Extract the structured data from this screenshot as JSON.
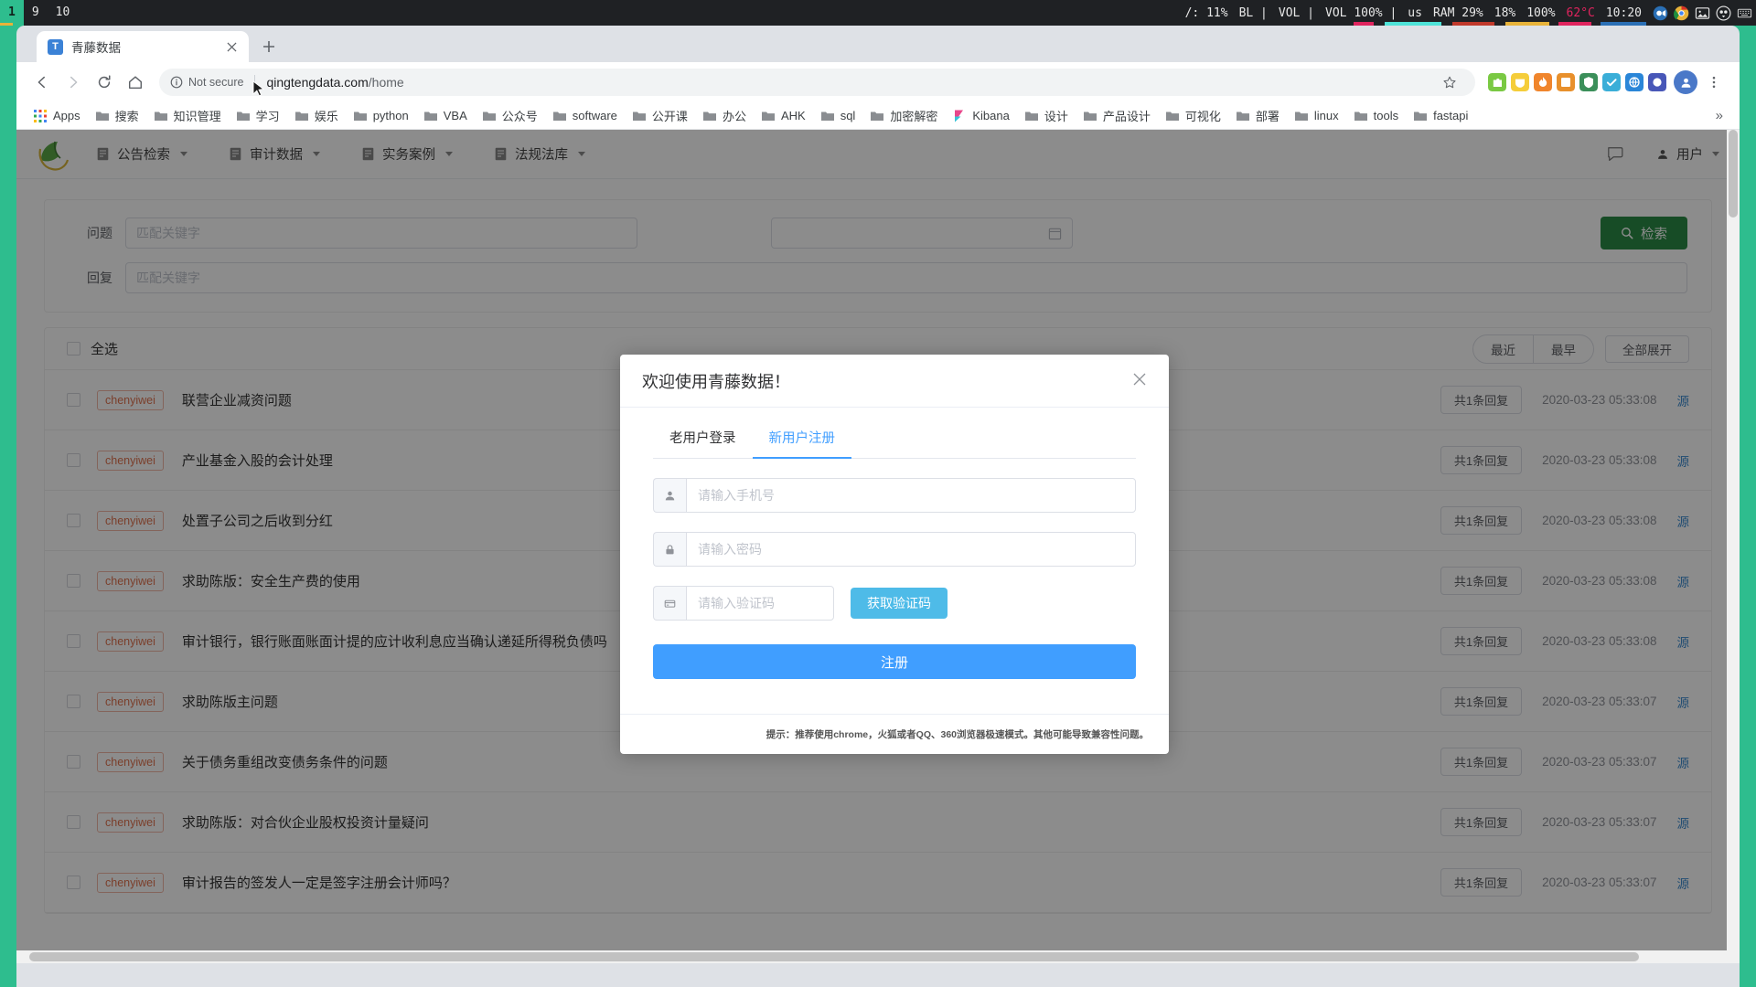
{
  "os_bar": {
    "workspaces": [
      "1",
      "9",
      "10"
    ],
    "active_workspace": "1",
    "segments": [
      {
        "name": "brightness",
        "text": "/: 11%"
      },
      {
        "name": "backlight",
        "text": "BL |"
      },
      {
        "name": "volume-label",
        "text": "VOL |"
      },
      {
        "name": "volume-level",
        "text": "VOL 100% |"
      },
      {
        "name": "keyboard-layout",
        "text": "us"
      },
      {
        "name": "ram",
        "text": "RAM 29%"
      },
      {
        "name": "cpu",
        "text": "18%"
      },
      {
        "name": "battery",
        "text": "100%"
      },
      {
        "name": "temperature",
        "text": "62°C"
      },
      {
        "name": "clock",
        "text": "10:20"
      }
    ],
    "tray_icons": [
      "camera-icon",
      "chrome-icon",
      "image-icon",
      "owl-icon",
      "keyboard-icon"
    ]
  },
  "browser": {
    "tab": {
      "title": "青藤数据",
      "favicon_letter": "T"
    },
    "new_tab_label": "+",
    "nav": {
      "back": "back-icon",
      "forward": "forward-icon",
      "reload": "reload-icon",
      "home": "home-icon"
    },
    "omnibox": {
      "security_text": "Not secure",
      "url_host": "qingtengdata.com",
      "url_path": "/home"
    },
    "bookmarks": [
      {
        "label": "Apps",
        "icon": "apps-grid-icon"
      },
      {
        "label": "搜索",
        "icon": "folder-icon"
      },
      {
        "label": "知识管理",
        "icon": "folder-icon"
      },
      {
        "label": "学习",
        "icon": "folder-icon"
      },
      {
        "label": "娱乐",
        "icon": "folder-icon"
      },
      {
        "label": "python",
        "icon": "folder-icon"
      },
      {
        "label": "VBA",
        "icon": "folder-icon"
      },
      {
        "label": "公众号",
        "icon": "folder-icon"
      },
      {
        "label": "software",
        "icon": "folder-icon"
      },
      {
        "label": "公开课",
        "icon": "folder-icon"
      },
      {
        "label": "办公",
        "icon": "folder-icon"
      },
      {
        "label": "AHK",
        "icon": "folder-icon"
      },
      {
        "label": "sql",
        "icon": "folder-icon"
      },
      {
        "label": "加密解密",
        "icon": "folder-icon"
      },
      {
        "label": "Kibana",
        "icon": "kibana-icon"
      },
      {
        "label": "设计",
        "icon": "folder-icon"
      },
      {
        "label": "产品设计",
        "icon": "folder-icon"
      },
      {
        "label": "可视化",
        "icon": "folder-icon"
      },
      {
        "label": "部署",
        "icon": "folder-icon"
      },
      {
        "label": "linux",
        "icon": "folder-icon"
      },
      {
        "label": "tools",
        "icon": "folder-icon"
      },
      {
        "label": "fastapi",
        "icon": "folder-icon"
      }
    ],
    "bookmarks_overflow": "»"
  },
  "site": {
    "nav_items": [
      {
        "label": "公告检索"
      },
      {
        "label": "审计数据"
      },
      {
        "label": "实务案例"
      },
      {
        "label": "法规法库"
      }
    ],
    "user_label": "用户"
  },
  "search_panel": {
    "question_label": "问题",
    "question_placeholder": "匹配关键字",
    "reply_label": "回复",
    "reply_placeholder": "匹配关键字",
    "date_placeholder": "",
    "search_button": "检索"
  },
  "list_header": {
    "select_all": "全选",
    "sort_recent": "最近",
    "sort_earliest": "最早",
    "expand_all": "全部展开"
  },
  "rows": [
    {
      "user": "chenyiwei",
      "question": "联营企业减资问题",
      "replies": "共1条回复",
      "time": "2020-03-23 05:33:08",
      "source": "源"
    },
    {
      "user": "chenyiwei",
      "question": "产业基金入股的会计处理",
      "replies": "共1条回复",
      "time": "2020-03-23 05:33:08",
      "source": "源"
    },
    {
      "user": "chenyiwei",
      "question": "处置子公司之后收到分红",
      "replies": "共1条回复",
      "time": "2020-03-23 05:33:08",
      "source": "源"
    },
    {
      "user": "chenyiwei",
      "question": "求助陈版：安全生产费的使用",
      "replies": "共1条回复",
      "time": "2020-03-23 05:33:08",
      "source": "源"
    },
    {
      "user": "chenyiwei",
      "question": "审计银行，银行账面账面计提的应计收利息应当确认递延所得税负债吗",
      "replies": "共1条回复",
      "time": "2020-03-23 05:33:08",
      "source": "源"
    },
    {
      "user": "chenyiwei",
      "question": "求助陈版主问题",
      "replies": "共1条回复",
      "time": "2020-03-23 05:33:07",
      "source": "源"
    },
    {
      "user": "chenyiwei",
      "question": "关于债务重组改变债务条件的问题",
      "replies": "共1条回复",
      "time": "2020-03-23 05:33:07",
      "source": "源"
    },
    {
      "user": "chenyiwei",
      "question": "求助陈版：对合伙企业股权投资计量疑问",
      "replies": "共1条回复",
      "time": "2020-03-23 05:33:07",
      "source": "源"
    },
    {
      "user": "chenyiwei",
      "question": "审计报告的签发人一定是签字注册会计师吗？",
      "replies": "共1条回复",
      "time": "2020-03-23 05:33:07",
      "source": "源"
    }
  ],
  "modal": {
    "title": "欢迎使用青藤数据！",
    "close": "×",
    "tabs": [
      {
        "label": "老用户登录",
        "active": false
      },
      {
        "label": "新用户注册",
        "active": true
      }
    ],
    "phone_placeholder": "请输入手机号",
    "password_placeholder": "请输入密码",
    "code_placeholder": "请输入验证码",
    "get_code_button": "获取验证码",
    "submit_button": "注册",
    "footer_note": "提示：推荐使用chrome，火狐或者QQ、360浏览器极速模式。其他可能导致兼容性问题。"
  },
  "colors": {
    "desktop": "#2ebd8e",
    "primary_blue": "#409eff",
    "code_blue": "#4ebbe8",
    "search_green": "#2a8a45",
    "tag_orange": "#e0734f"
  }
}
